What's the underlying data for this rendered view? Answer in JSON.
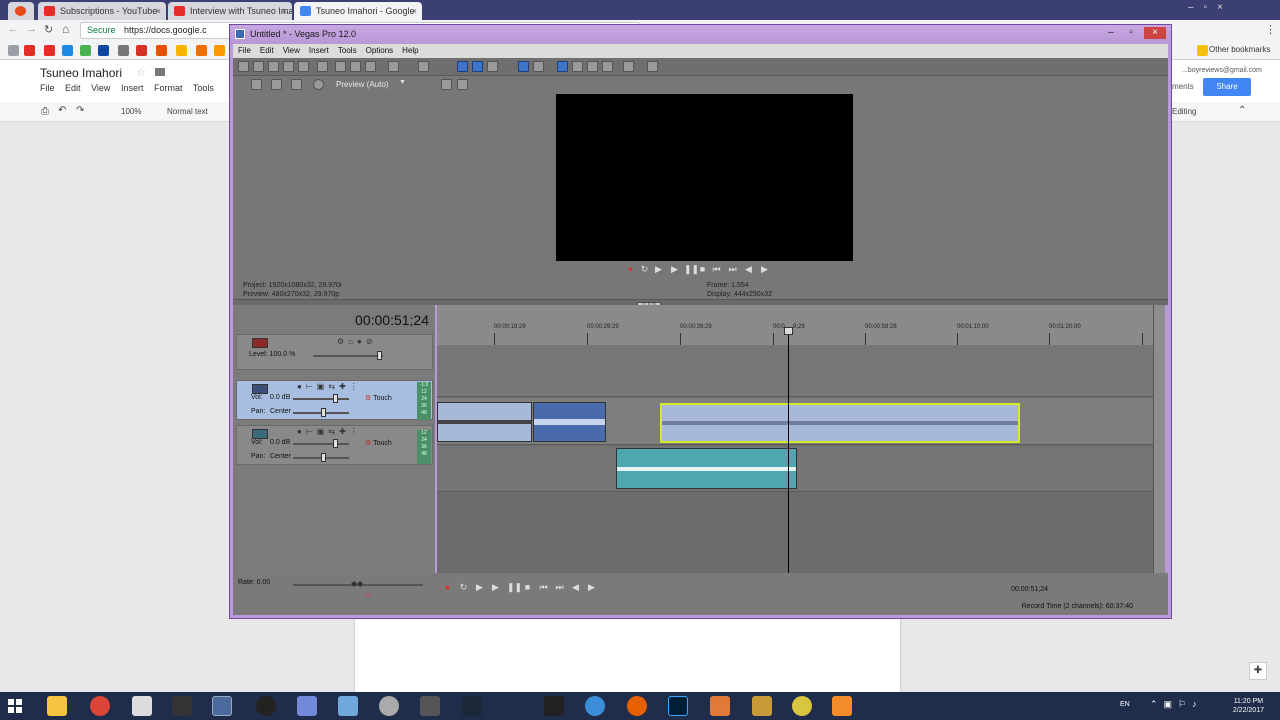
{
  "browser": {
    "tabs": [
      {
        "label": "Subscriptions - YouTube",
        "favicon_color": "#e52d27"
      },
      {
        "label": "Interview with Tsuneo Ima",
        "favicon_color": "#e52d27"
      },
      {
        "label": "Tsuneo Imahori - Google",
        "favicon_color": "#4285f4"
      }
    ],
    "close_glyph": "×",
    "secure_label": "Secure",
    "url": "https://docs.google.c",
    "other_bookmarks": "Other bookmarks",
    "account": "...boyreviews@gmail.com"
  },
  "docs": {
    "title": "Tsuneo Imahori",
    "menu": [
      "File",
      "Edit",
      "View",
      "Insert",
      "Format",
      "Tools"
    ],
    "zoom": "100%",
    "style": "Normal text",
    "comments_label": "ments",
    "share_label": "Share",
    "editing_label": "Editing"
  },
  "vegas": {
    "title": "Untitled * - Vegas Pro 12.0",
    "menu": [
      "File",
      "Edit",
      "View",
      "Insert",
      "Tools",
      "Options",
      "Help"
    ],
    "preview_mode": "Preview (Auto)",
    "project_info": "Project:  1920x1080x32, 29.970i",
    "preview_info": "Preview:  480x270x32, 29.970p",
    "frame_info": "Frame:    1,554",
    "display_info": "Display:  444x250x32",
    "current_time": "00:00:51;24",
    "master_level": "Level: 100.0 %",
    "tracks": [
      {
        "vol": "0.0 dB",
        "pan": "Center",
        "mode": "Touch",
        "meter": [
          "-1.0",
          "12",
          "24",
          "36",
          "48"
        ]
      },
      {
        "vol": "0.0 dB",
        "pan": "Center",
        "mode": "Touch",
        "meter": [
          "12",
          "24",
          "36",
          "48"
        ]
      }
    ],
    "labels": {
      "vol": "Vol:",
      "pan": "Pan:"
    },
    "ruler_ticks": [
      "00:00:19;29",
      "00:00:29;29",
      "00:00:39;29",
      "00:0",
      "9;29",
      "00:00:59;28",
      "00:01:10;00",
      "00:01:20;00"
    ],
    "rate": "Rate: 0.00",
    "bottom_time": "00:00:51;24",
    "record_time": "Record Time (2 channels): 60:37:40",
    "marker_tag": "[1.9.9]",
    "colors": {
      "clip_blue": "#4a6aae",
      "clip_light": "#a8b8d8",
      "clip_teal": "#4da6b0",
      "selection_outline": "#d8e82a",
      "window_frame": "#b99ad9"
    }
  },
  "taskbar": {
    "lang": "EN",
    "time": "11:20 PM",
    "date": "2/22/2017"
  }
}
